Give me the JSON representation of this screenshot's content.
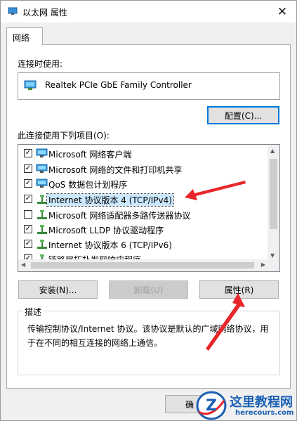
{
  "window": {
    "title": "以太网 属性"
  },
  "tabs": [
    {
      "label": "网络"
    }
  ],
  "connect_using": {
    "label": "连接时使用:",
    "adapter": "Realtek PCIe GbE Family Controller",
    "configure_button": "配置(C)..."
  },
  "items": {
    "label": "此连接使用下列项目(O):",
    "list": [
      {
        "label": "Microsoft 网络客户端",
        "checked": true,
        "icon": "network-client-icon"
      },
      {
        "label": "Microsoft 网络的文件和打印机共享",
        "checked": true,
        "icon": "network-client-icon"
      },
      {
        "label": "QoS 数据包计划程序",
        "checked": true,
        "icon": "network-client-icon"
      },
      {
        "label": "Internet 协议版本 4 (TCP/IPv4)",
        "checked": true,
        "icon": "protocol-icon",
        "selected": true
      },
      {
        "label": "Microsoft 网络适配器多路传送器协议",
        "checked": false,
        "icon": "protocol-icon"
      },
      {
        "label": "Microsoft LLDP 协议驱动程序",
        "checked": true,
        "icon": "protocol-icon"
      },
      {
        "label": "Internet 协议版本 6 (TCP/IPv6)",
        "checked": true,
        "icon": "protocol-icon"
      },
      {
        "label": "链路层拓扑发现响应程序",
        "checked": true,
        "icon": "protocol-icon"
      }
    ]
  },
  "buttons": {
    "install": "安装(N)...",
    "uninstall": "卸载(U)",
    "properties": "属性(R)"
  },
  "description": {
    "title": "描述",
    "text": "传输控制协议/Internet 协议。该协议是默认的广域网络协议，用于在不同的相互连接的网络上通信。"
  },
  "footer": {
    "ok_partial": "确"
  },
  "watermark": {
    "title": "这里教程网",
    "domain": "herecours.com",
    "letter": "Z"
  },
  "colors": {
    "accent": "#0078d7",
    "selection": "#cce8ff",
    "arrow": "#e8262b",
    "watermark": "#1a5fb4"
  }
}
